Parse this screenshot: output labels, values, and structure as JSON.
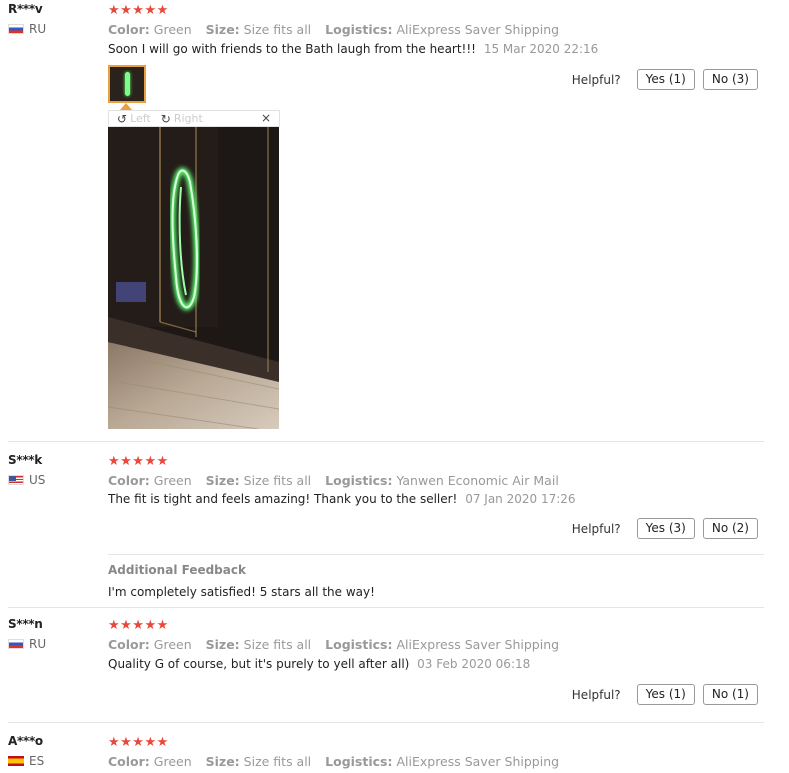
{
  "labels": {
    "color": "Color:",
    "size": "Size:",
    "logistics": "Logistics:",
    "helpful": "Helpful?"
  },
  "reviews": [
    {
      "user": "R***v",
      "country": "RU",
      "stars": "★★★★★",
      "color": "Green",
      "size": "Size fits all",
      "logistics": "AliExpress Saver Shipping",
      "text": "Soon I will go with friends to the Bath laugh from the heart!!!",
      "date": "15 Mar 2020 22:16",
      "yes": "Yes (1)",
      "no": "No (3)",
      "viewer": {
        "left": "Left",
        "right": "Right",
        "close": "×",
        "rotate_left_icon": "↺",
        "rotate_right_icon": "↻"
      }
    },
    {
      "user": "S***k",
      "country": "US",
      "stars": "★★★★★",
      "color": "Green",
      "size": "Size fits all",
      "logistics": "Yanwen Economic Air Mail",
      "text": "The fit is tight and feels amazing! Thank you to the seller!",
      "date": "07 Jan 2020 17:26",
      "yes": "Yes (3)",
      "no": "No (2)",
      "additional_title": "Additional Feedback",
      "additional_text": "I'm completely satisfied! 5 stars all the way!"
    },
    {
      "user": "S***n",
      "country": "RU",
      "stars": "★★★★★",
      "color": "Green",
      "size": "Size fits all",
      "logistics": "AliExpress Saver Shipping",
      "text": "Quality G of course, but it's purely to yell after all)",
      "date": "03 Feb 2020 06:18",
      "yes": "Yes (1)",
      "no": "No (1)"
    },
    {
      "user": "A***o",
      "country": "ES",
      "stars": "★★★★★",
      "color": "Green",
      "size": "Size fits all",
      "logistics": "AliExpress Saver Shipping"
    }
  ],
  "colors": {
    "star": "#e8493b",
    "thumb_border": "#e8a040"
  }
}
